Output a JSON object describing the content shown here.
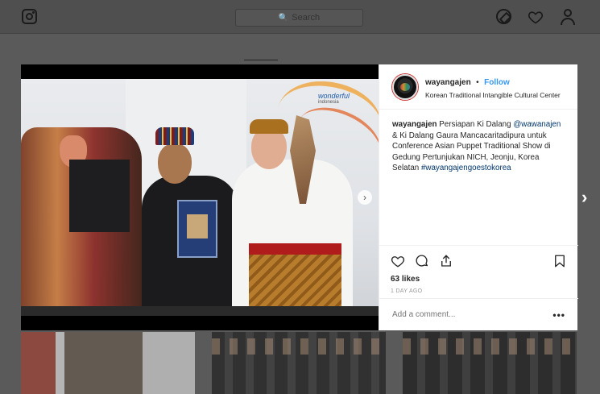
{
  "topbar": {
    "search_placeholder": "Search",
    "icons": [
      "instagram-logo-icon",
      "search-icon",
      "compass-icon",
      "heart-icon",
      "profile-icon"
    ]
  },
  "post": {
    "username": "wayangajen",
    "separator": "•",
    "follow_label": "Follow",
    "location": "Korean Traditional Intangible Cultural Center",
    "caption": {
      "user": "wayangajen",
      "text_1": " Persiapan Ki Dalang ",
      "mention_1": "@wawanajen",
      "text_2": " & Ki Dalang Gaura Mancacaritadipura untuk Conference Asian Puppet Traditional Show di Gedung Pertunjukan NICH, Jeonju, Korea Selatan ",
      "hashtag": "#wayangajengoestokorea"
    },
    "likes": "63 likes",
    "time_ago": "1 DAY AGO",
    "comment_placeholder": "Add a comment...",
    "more_label": "•••",
    "photo_brand": {
      "line1": "wonderful",
      "line2": "indonesia"
    }
  },
  "colors": {
    "link": "#3897f0",
    "mention": "#003569",
    "overlay": "#5a5a5a"
  }
}
